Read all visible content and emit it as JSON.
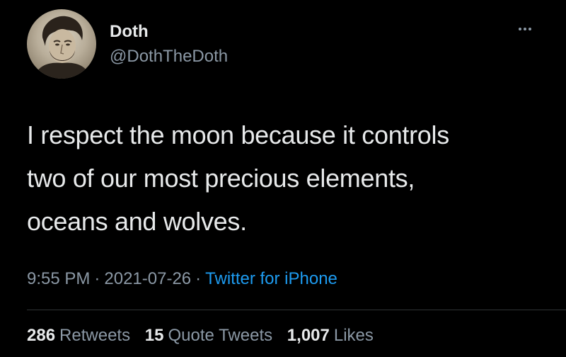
{
  "author": {
    "name": "Doth",
    "handle": "@DothTheDoth"
  },
  "tweet": {
    "lines": [
      "I respect the moon because it controls",
      "two of our most precious elements,",
      "oceans and wolves."
    ]
  },
  "meta": {
    "time": "9:55 PM",
    "separator": "·",
    "date": "2021-07-26",
    "source": "Twitter for iPhone"
  },
  "stats": {
    "retweets": {
      "count": "286",
      "label": "Retweets"
    },
    "quotes": {
      "count": "15",
      "label": "Quote Tweets"
    },
    "likes": {
      "count": "1,007",
      "label": "Likes"
    }
  },
  "icons": {
    "more": "more-horizontal-icon"
  },
  "colors": {
    "background": "#000000",
    "text": "#e7e9ea",
    "secondary": "#8b98a5",
    "link": "#1d9bf0",
    "divider": "#2f3336"
  }
}
